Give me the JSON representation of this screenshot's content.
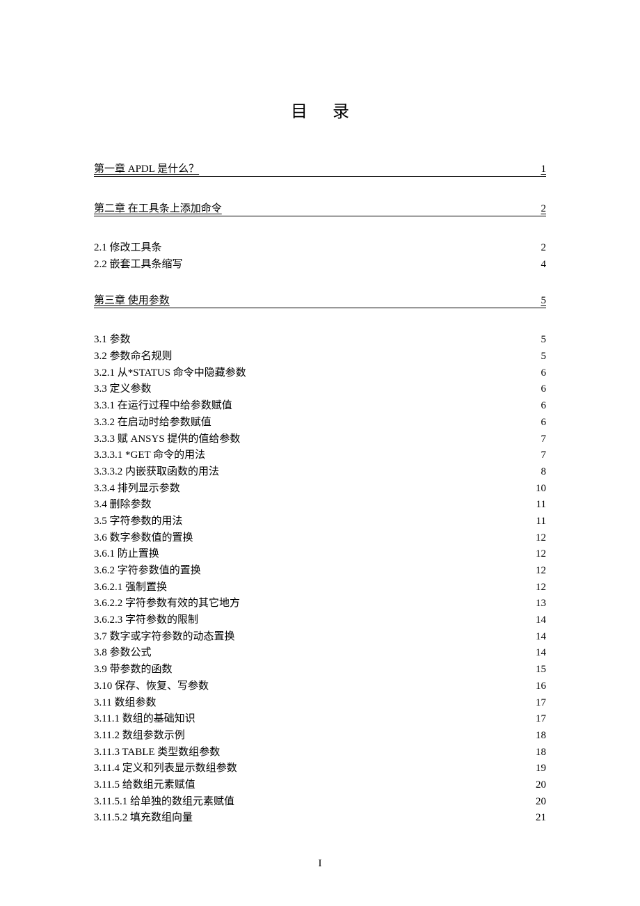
{
  "title": "目录",
  "footer": "I",
  "chapters": [
    {
      "label": "第一章 APDL 是什么？",
      "page": "1",
      "entries": []
    },
    {
      "label": "第二章 在工具条上添加命令",
      "page": "2",
      "entries": [
        {
          "label": "2.1 修改工具条",
          "page": "2"
        },
        {
          "label": "2.2 嵌套工具条缩写",
          "page": "4"
        }
      ]
    },
    {
      "label": "第三章 使用参数",
      "page": "5",
      "entries": [
        {
          "label": "3.1 参数",
          "page": "5"
        },
        {
          "label": "3.2 参数命名规则",
          "page": "5"
        },
        {
          "label": "3.2.1 从*STATUS 命令中隐藏参数",
          "page": "6"
        },
        {
          "label": "3.3 定义参数",
          "page": "6"
        },
        {
          "label": "3.3.1 在运行过程中给参数赋值",
          "page": "6"
        },
        {
          "label": "3.3.2 在启动时给参数赋值",
          "page": "6"
        },
        {
          "label": "3.3.3 赋 ANSYS 提供的值给参数",
          "page": "7"
        },
        {
          "label": "3.3.3.1 *GET 命令的用法",
          "page": "7"
        },
        {
          "label": "3.3.3.2 内嵌获取函数的用法",
          "page": "8"
        },
        {
          "label": "3.3.4 排列显示参数",
          "page": "10"
        },
        {
          "label": "3.4 删除参数",
          "page": "11"
        },
        {
          "label": "3.5 字符参数的用法",
          "page": "11"
        },
        {
          "label": "3.6 数字参数值的置换",
          "page": "12"
        },
        {
          "label": "3.6.1 防止置换",
          "page": "12"
        },
        {
          "label": "3.6.2 字符参数值的置换",
          "page": "12"
        },
        {
          "label": "3.6.2.1 强制置换",
          "page": "12"
        },
        {
          "label": "3.6.2.2 字符参数有效的其它地方",
          "page": "13"
        },
        {
          "label": "3.6.2.3 字符参数的限制",
          "page": "14"
        },
        {
          "label": "3.7 数字或字符参数的动态置换",
          "page": "14"
        },
        {
          "label": "3.8 参数公式",
          "page": "14"
        },
        {
          "label": "3.9 带参数的函数",
          "page": "15"
        },
        {
          "label": "3.10 保存、恢复、写参数",
          "page": "16"
        },
        {
          "label": "3.11 数组参数",
          "page": "17"
        },
        {
          "label": "3.11.1 数组的基础知识",
          "page": "17"
        },
        {
          "label": "3.11.2 数组参数示例",
          "page": "18"
        },
        {
          "label": "3.11.3 TABLE 类型数组参数",
          "page": "18"
        },
        {
          "label": "3.11.4 定义和列表显示数组参数",
          "page": "19"
        },
        {
          "label": "3.11.5 给数组元素赋值",
          "page": "20"
        },
        {
          "label": "3.11.5.1 给单独的数组元素赋值",
          "page": "20"
        },
        {
          "label": "3.11.5.2 填充数组向量",
          "page": "21"
        }
      ]
    }
  ]
}
